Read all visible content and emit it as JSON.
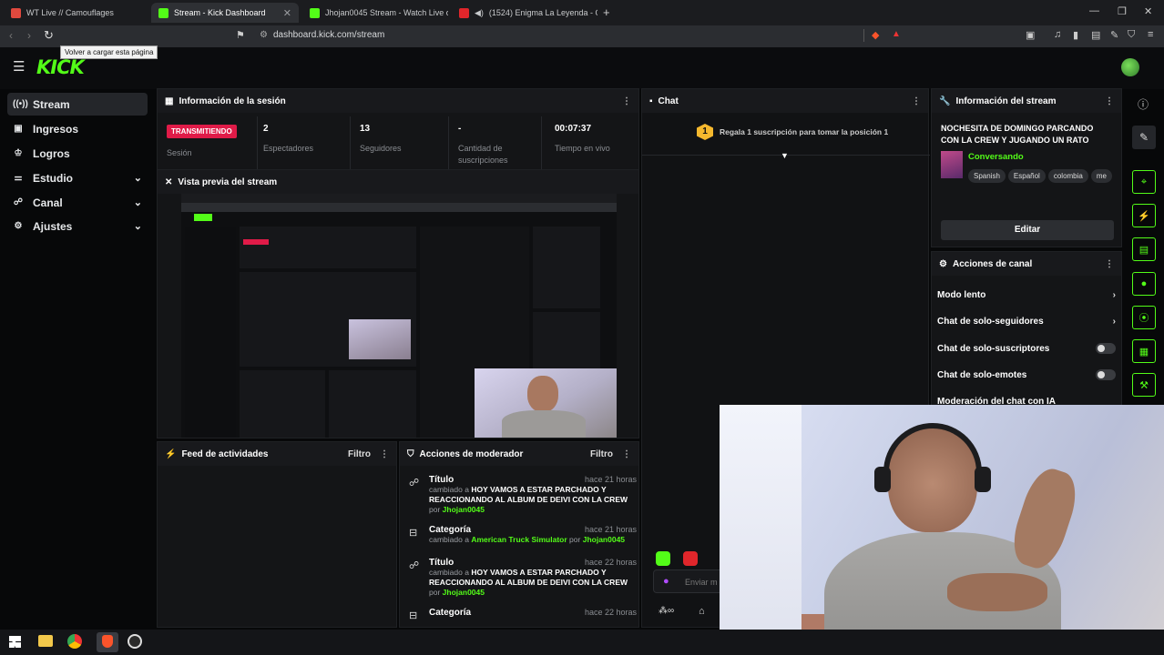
{
  "browser": {
    "tabs": [
      {
        "label": "WT Live // Camouflages",
        "color": "#e0493e"
      },
      {
        "label": "Stream - Kick Dashboard",
        "color": "#53fc18"
      },
      {
        "label": "Jhojan0045 Stream - Watch Live on K",
        "color": "#53fc18"
      },
      {
        "label": "(1524) Enigma La Leyenda - Obs",
        "color": "#e0262b"
      }
    ],
    "url": "dashboard.kick.com/stream",
    "tooltip": "Volver a cargar esta página"
  },
  "brand": {
    "logo": "KICK",
    "accent": "#53fc18",
    "live_color": "#e01b48"
  },
  "sidebar": {
    "items": [
      {
        "label": "Stream",
        "icon": "broadcast-icon"
      },
      {
        "label": "Ingresos",
        "icon": "wallet-icon"
      },
      {
        "label": "Logros",
        "icon": "trophy-icon"
      },
      {
        "label": "Estudio",
        "icon": "sliders-icon"
      },
      {
        "label": "Canal",
        "icon": "users-icon"
      },
      {
        "label": "Ajustes",
        "icon": "gear-icon"
      }
    ]
  },
  "session": {
    "title": "Información de la sesión",
    "status": "TRANSMITIENDO",
    "status_label": "Sesión",
    "viewers": "2",
    "viewers_label": "Espectadores",
    "followers": "13",
    "followers_label": "Seguidores",
    "subs": "-",
    "subs_label": "Cantidad de suscripciones",
    "uptime": "00:07:37",
    "uptime_label": "Tiempo en vivo"
  },
  "preview": {
    "title": "Vista previa del stream"
  },
  "activity": {
    "title": "Feed de actividades",
    "filter": "Filtro"
  },
  "moderator": {
    "title": "Acciones de moderador",
    "filter": "Filtro",
    "items": [
      {
        "type": "Título",
        "ago": "hace 21 horas",
        "pre": "cambiado a",
        "value": "HOY VAMOS A ESTAR PARCHADO Y REACCIONANDO AL ALBUM DE DEIVI CON LA CREW",
        "by": "por",
        "user": "Jhojan0045",
        "icon": "users-icon"
      },
      {
        "type": "Categoría",
        "ago": "hace 21 horas",
        "pre": "cambiado a",
        "value": "American Truck Simulator",
        "by": "por",
        "user": "Jhojan0045",
        "icon": "category-icon"
      },
      {
        "type": "Título",
        "ago": "hace 22 horas",
        "pre": "cambiado a",
        "value": "HOY VAMOS A ESTAR PARCHADO Y REACCIONANDO AL ALBUM DE DEIVI CON LA CREW",
        "by": "por",
        "user": "Jhojan0045",
        "icon": "users-icon"
      },
      {
        "type": "Categoría",
        "ago": "hace 22 horas",
        "icon": "category-icon"
      }
    ]
  },
  "chat": {
    "title": "Chat",
    "gift_text": "Regala 1 suscripción para tomar la posición 1",
    "rank": "1",
    "input_placeholder": "Enviar m"
  },
  "stream_info": {
    "title": "Información del stream",
    "stream_title": "NOCHESITA DE DOMINGO PARCANDO CON LA CREW Y JUGANDO UN RATO",
    "category": "Conversando",
    "tags": [
      "Spanish",
      "Español",
      "colombia",
      "me"
    ],
    "edit": "Editar"
  },
  "channel_actions": {
    "title": "Acciones de canal",
    "items": [
      {
        "label": "Modo lento",
        "control": "chevron"
      },
      {
        "label": "Chat de solo-seguidores",
        "control": "chevron"
      },
      {
        "label": "Chat de solo-suscriptores",
        "control": "toggle"
      },
      {
        "label": "Chat de solo-emotes",
        "control": "toggle"
      },
      {
        "label": "Moderación del chat con IA",
        "control": "chevron"
      }
    ]
  }
}
